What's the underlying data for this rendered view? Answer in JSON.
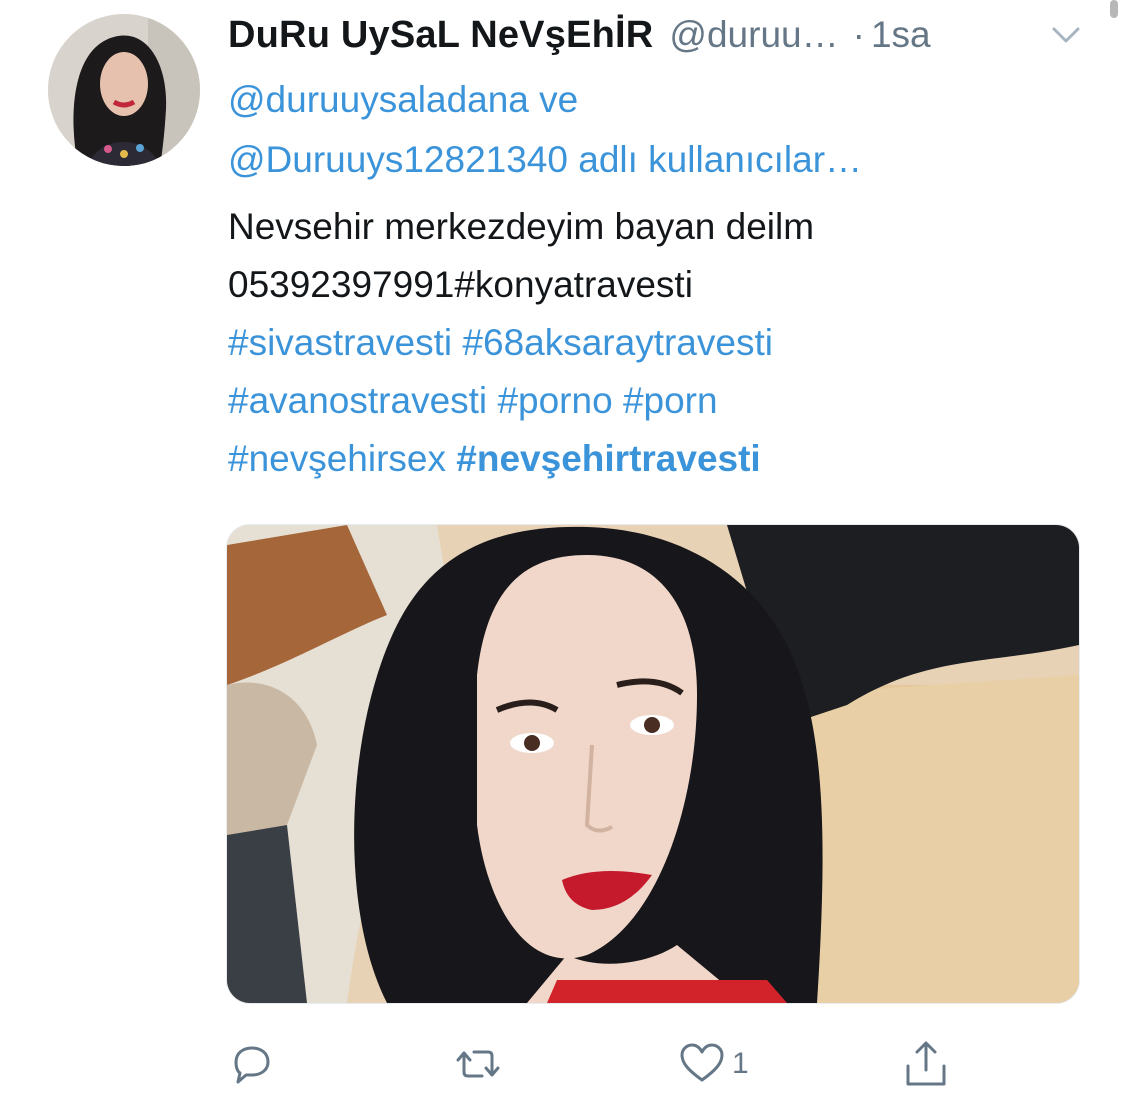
{
  "tweet": {
    "display_name": "DuRu UySaL NeVşEhİR",
    "handle": "@duruu…",
    "separator": "·",
    "timestamp": "1sa",
    "reply_context_line1": "@duruuysaladana ve",
    "reply_context_line2": "@Duruuys12821340 adlı kullanıcılar…",
    "text_line1": "Nevsehir merkezdeyim bayan deilm",
    "text_line2_plain": "05392397991#konyatravesti",
    "hashtags": [
      "#sivastravesti",
      "#68aksaraytravesti",
      "#avanostravesti",
      "#porno",
      "#porn",
      "#nevşehirsex",
      "#nevşehirtravesti"
    ],
    "like_count": "1"
  },
  "icons": {
    "caret": "chevron-down-icon",
    "reply": "reply-icon",
    "retweet": "retweet-icon",
    "like": "heart-icon",
    "share": "share-icon"
  },
  "colors": {
    "text": "#14171a",
    "secondary": "#657786",
    "link": "#3b94d9"
  }
}
